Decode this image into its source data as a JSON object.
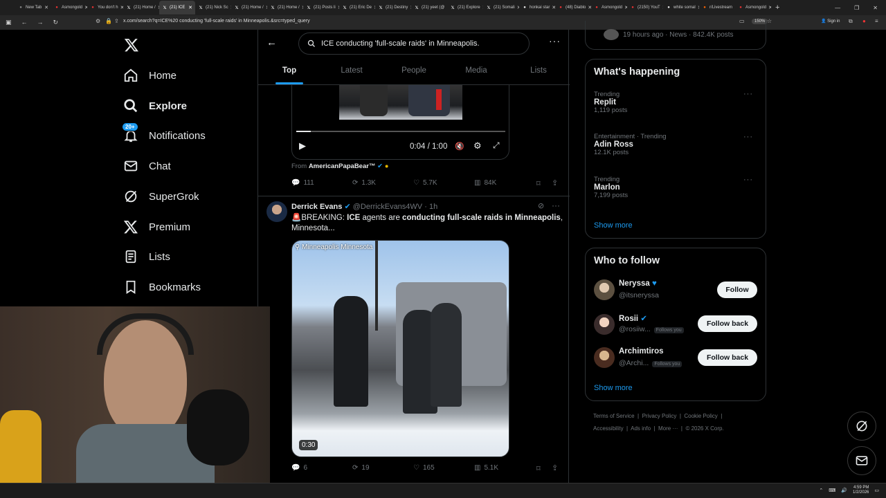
{
  "browser": {
    "tabs": [
      "New Tab",
      "Asmongold",
      "You don't h",
      "(21) Home /",
      "(21) ICE",
      "(21) Nick Sc",
      "(21) Home /",
      "(21) Home /",
      "(21) Posts li",
      "(21) Eric De",
      "(21) Destiny",
      "(21) yeet (@",
      "(21) Explore",
      "(21) Somali",
      "honkai star",
      "(48) Diablo",
      "Asmongold",
      "(2150) YouT",
      "white somal",
      "r/Livestream",
      "Asmongold"
    ],
    "url": "x.com/search?q=ICE%20 conducting 'full-scale raids' in Minneapolis.&src=typed_query",
    "zoom": "150%",
    "signin": "Sign in"
  },
  "nav": {
    "home": "Home",
    "explore": "Explore",
    "notifications": "Notifications",
    "notif_badge": "20+",
    "chat": "Chat",
    "supergrok": "SuperGrok",
    "premium": "Premium",
    "lists": "Lists",
    "bookmarks": "Bookmarks"
  },
  "search": {
    "query": "ICE  conducting 'full-scale raids' in Minneapolis.",
    "tabs": [
      "Top",
      "Latest",
      "People",
      "Media",
      "Lists"
    ]
  },
  "video1": {
    "time": "0:04 / 1:00",
    "from_label": "From",
    "from_name": "AmericanPapaBear™",
    "progress": 0.07,
    "replies": "111",
    "reposts": "1.3K",
    "likes": "5.7K",
    "views": "84K"
  },
  "tweet2": {
    "name": "Derrick Evans",
    "handle": "@DerrickEvans4WV",
    "time": "1h",
    "text_prefix": "🚨BREAKING: ",
    "text_b1": "ICE",
    "text_mid": " agents are ",
    "text_b2": "conducting full-scale raids in Minneapolis",
    "text_end": ", Minnesota...",
    "location": "Minneapolis Minnesota",
    "duration": "0:30",
    "replies": "6",
    "reposts": "19",
    "likes": "165",
    "views": "5.1K"
  },
  "right": {
    "top_meta": "19 hours ago · News · 842.4K posts",
    "happening_title": "What's happening",
    "trends": [
      {
        "cat": "Trending",
        "name": "Replit",
        "count": "1,119 posts"
      },
      {
        "cat": "Entertainment · Trending",
        "name": "Adin Ross",
        "count": "12.1K posts"
      },
      {
        "cat": "Trending",
        "name": "Marlon",
        "count": "7,199 posts"
      }
    ],
    "show_more": "Show more",
    "wtf_title": "Who to follow",
    "follows": [
      {
        "name": "Neryssa",
        "handle": "@itsneryssa",
        "btn": "Follow",
        "follows_you": ""
      },
      {
        "name": "Rosii",
        "handle": "@rosiiw...",
        "btn": "Follow back",
        "follows_you": "Follows you"
      },
      {
        "name": "Archimtiros",
        "handle": "@Archi...",
        "btn": "Follow back",
        "follows_you": "Follows you"
      }
    ],
    "show_more2": "Show more",
    "footer1": [
      "Terms of Service",
      "Privacy Policy",
      "Cookie Policy"
    ],
    "footer2": [
      "Accessibility",
      "Ads info",
      "More ···",
      "© 2026 X Corp."
    ]
  },
  "taskbar": {
    "time": "4:59 PM",
    "date": "1/2/2026"
  },
  "colors": {
    "accent": "#1d9bf0",
    "bg": "#000000",
    "border": "#2f3336",
    "muted": "#71767b"
  }
}
